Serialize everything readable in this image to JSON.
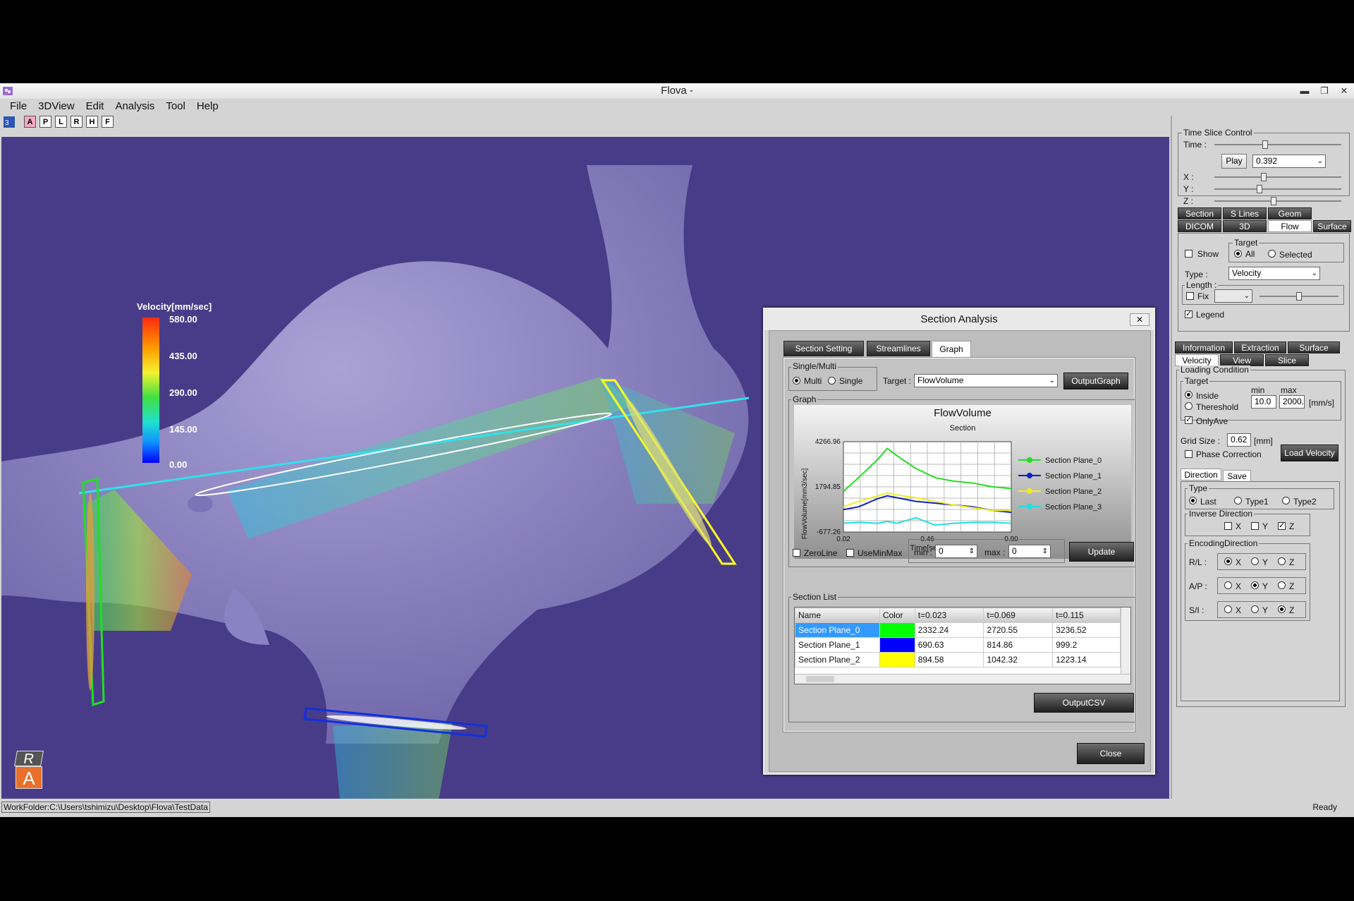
{
  "window": {
    "title": "Flova -",
    "minimize": "▬",
    "restore": "❐",
    "close": "✕"
  },
  "menu": [
    "File",
    "3DView",
    "Edit",
    "Analysis",
    "Tool",
    "Help"
  ],
  "toolbar": [
    "A",
    "P",
    "L",
    "R",
    "H",
    "F"
  ],
  "legend": {
    "title": "Velocity[mm/sec]",
    "ticks": [
      "580.00",
      "435.00",
      "290.00",
      "145.00",
      "0.00"
    ]
  },
  "orientation": {
    "top": "R",
    "bottom": "A"
  },
  "status": {
    "workfolder": "WorkFolder:C:\\Users\\tshimizu\\Desktop\\Flova\\TestData",
    "state": "Ready"
  },
  "right_panel": {
    "time_slice": {
      "title": "Time Slice Control",
      "time_label": "Time :",
      "play": "Play",
      "time_value": "0.392",
      "x": "X :",
      "y": "Y :",
      "z": "Z :"
    },
    "tabs_row1": [
      "Section",
      "S Lines",
      "Geom"
    ],
    "tabs_row2": [
      "DICOM",
      "3D",
      "Flow",
      "Surface"
    ],
    "flow": {
      "show": "Show",
      "target_title": "Target",
      "all": "All",
      "selected": "Selected",
      "type_label": "Type :",
      "type_value": "Velocity",
      "length_title": "Length :",
      "fix": "Fix",
      "legend": "Legend"
    },
    "tabs_row3": [
      "Information",
      "Extraction",
      "Surface"
    ],
    "tabs_row4": [
      "Velocity",
      "View",
      "Slice"
    ],
    "loading": {
      "title": "Loading Condition",
      "target_title": "Target",
      "inside": "Inside",
      "threshold": "Thereshold",
      "min_label": "min",
      "max_label": "max",
      "min_value": "10.0",
      "max_value": "2000.",
      "unit": "[mm/s]",
      "onlyave": "OnlyAve",
      "grid_label": "Grid Size :",
      "grid_value": "0.62",
      "grid_unit": "[mm]",
      "phase": "Phase Correction",
      "load_button": "Load Velocity"
    },
    "tabs_row5": [
      "Direction",
      "Save"
    ],
    "direction": {
      "type_title": "Type",
      "last": "Last",
      "type1": "Type1",
      "type2": "Type2",
      "inverse_title": "Inverse Direction",
      "x": "X",
      "y": "Y",
      "z": "Z",
      "encoding_title": "EncodingDirection",
      "rl": "R/L :",
      "ap": "A/P :",
      "si": "S/I :"
    }
  },
  "dialog": {
    "title": "Section Analysis",
    "close_x": "✕",
    "tabs": [
      "Section Setting",
      "Streamlines",
      "Graph"
    ],
    "single_multi": {
      "title": "Single/Multi",
      "multi": "Multi",
      "single": "Single"
    },
    "target_label": "Target :",
    "target_value": "FlowVolume",
    "output_graph": "OutputGraph",
    "graph_frame": "Graph",
    "zeroline": "ZeroLine",
    "useminmax": "UseMinMax",
    "min_label": "min :",
    "min_value": "0",
    "max_label": "max :",
    "max_value": "0",
    "update": "Update",
    "section_list": "Section List",
    "table": {
      "headers": [
        "Name",
        "Color",
        "t=0.023",
        "t=0.069",
        "t=0.115"
      ],
      "rows": [
        {
          "name": "Section Plane_0",
          "color": "#00ff00",
          "v1": "2332.24",
          "v2": "2720.55",
          "v3": "3236.52"
        },
        {
          "name": "Section Plane_1",
          "color": "#0000ff",
          "v1": "690.63",
          "v2": "814.86",
          "v3": "999.2"
        },
        {
          "name": "Section Plane_2",
          "color": "#ffff00",
          "v1": "894.58",
          "v2": "1042.32",
          "v3": "1223.14"
        }
      ]
    },
    "output_csv": "OutputCSV",
    "close": "Close"
  },
  "chart_data": {
    "type": "line",
    "title": "FlowVolume",
    "subtitle": "Section",
    "xlabel": "Time[sec]",
    "ylabel": "FlowVolume[mm3/sec]",
    "xlim": [
      0.02,
      0.9
    ],
    "ylim": [
      -677.26,
      4266.96
    ],
    "xticks": [
      "0.02",
      "0.46",
      "0.90"
    ],
    "yticks": [
      "4266.96",
      "1794.85",
      "-677.26"
    ],
    "x": [
      0.02,
      0.1,
      0.2,
      0.25,
      0.3,
      0.4,
      0.5,
      0.6,
      0.7,
      0.8,
      0.9
    ],
    "series": [
      {
        "name": "Section Plane_0",
        "color": "#22dd22",
        "values": [
          1550,
          2300,
          3300,
          3900,
          3500,
          2800,
          2300,
          2100,
          2000,
          1800,
          1700
        ]
      },
      {
        "name": "Section Plane_1",
        "color": "#1020c0",
        "values": [
          550,
          700,
          1150,
          1300,
          1200,
          1000,
          900,
          800,
          700,
          500,
          400
        ]
      },
      {
        "name": "Section Plane_2",
        "color": "#eeee22",
        "values": [
          700,
          1000,
          1300,
          1450,
          1350,
          1200,
          1000,
          800,
          650,
          500,
          500
        ]
      },
      {
        "name": "Section Plane_3",
        "color": "#22dddd",
        "values": [
          -200,
          -150,
          -200,
          -100,
          -200,
          100,
          -300,
          -200,
          -150,
          -150,
          -200
        ]
      }
    ],
    "grid": true,
    "legend": "right"
  }
}
